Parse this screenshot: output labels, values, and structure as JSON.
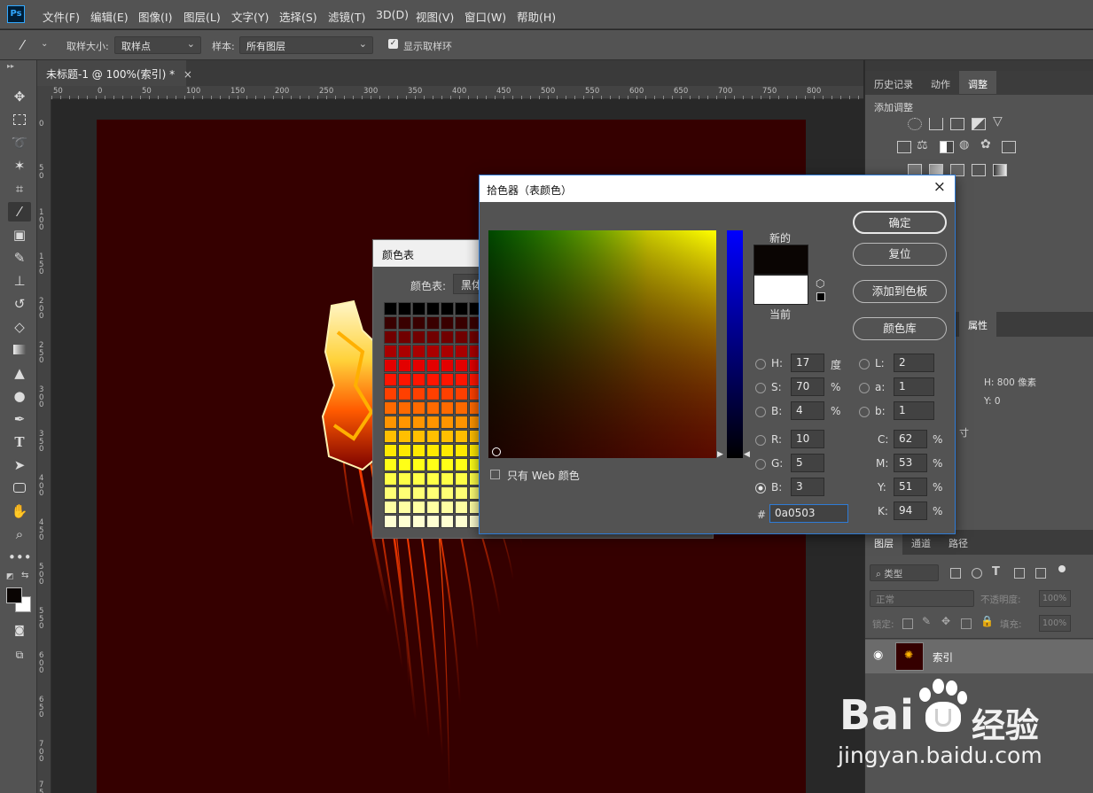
{
  "menubar": {
    "logo": "Ps",
    "items": [
      "文件(F)",
      "编辑(E)",
      "图像(I)",
      "图层(L)",
      "文字(Y)",
      "选择(S)",
      "滤镜(T)",
      "3D(D)",
      "视图(V)",
      "窗口(W)",
      "帮助(H)"
    ]
  },
  "options": {
    "sample_size_label": "取样大小:",
    "sample_size_value": "取样点",
    "sample_label": "样本:",
    "sample_value": "所有图层",
    "show_ring_label": "显示取样环"
  },
  "document_tab": {
    "title": "未标题-1 @ 100%(索引) *",
    "close": "×"
  },
  "ruler_h": [
    "50",
    "0",
    "50",
    "100",
    "150",
    "200",
    "250",
    "300",
    "350",
    "400",
    "450",
    "500",
    "550",
    "600",
    "650",
    "700",
    "750",
    "800"
  ],
  "ruler_v": [
    "0",
    "50",
    "100",
    "150",
    "200",
    "250",
    "300",
    "350",
    "400",
    "450",
    "500",
    "550",
    "600",
    "650",
    "700",
    "750"
  ],
  "colortable": {
    "title": "颜色表",
    "table_label": "颜色表:",
    "table_value": "黑体"
  },
  "picker": {
    "title": "拾色器（表颜色）",
    "close": "×",
    "new_label": "新的",
    "current_label": "当前",
    "new_color": "#0a0503",
    "current_color": "#ffffff",
    "ok": "确定",
    "reset": "复位",
    "add_swatch": "添加到色板",
    "color_libraries": "颜色库",
    "web_only": "只有 Web 颜色",
    "hsb": [
      {
        "label": "H:",
        "value": "17",
        "unit": "度"
      },
      {
        "label": "S:",
        "value": "70",
        "unit": "%"
      },
      {
        "label": "B:",
        "value": "4",
        "unit": "%"
      }
    ],
    "rgb": [
      {
        "label": "R:",
        "value": "10"
      },
      {
        "label": "G:",
        "value": "5"
      },
      {
        "label": "B:",
        "value": "3"
      }
    ],
    "lab": [
      {
        "label": "L:",
        "value": "2"
      },
      {
        "label": "a:",
        "value": "1"
      },
      {
        "label": "b:",
        "value": "1"
      }
    ],
    "cmyk": [
      {
        "label": "C:",
        "value": "62",
        "unit": "%"
      },
      {
        "label": "M:",
        "value": "53",
        "unit": "%"
      },
      {
        "label": "Y:",
        "value": "51",
        "unit": "%"
      },
      {
        "label": "K:",
        "value": "94",
        "unit": "%"
      }
    ],
    "hex_label": "#",
    "hex_value": "0a0503"
  },
  "right_panel": {
    "tabs": [
      "历史记录",
      "动作",
      "调整"
    ],
    "add_adjustment": "添加调整",
    "properties_tab": "属性",
    "prop_h": "H:  800 像素",
    "prop_y": "Y:  0",
    "prop_partial": "寸",
    "layers_tabs": [
      "图层",
      "通道",
      "路径"
    ],
    "filter_kind": "类型",
    "blend_mode": "正常",
    "opacity_label": "不透明度:",
    "opacity_value": "100%",
    "lock_label": "锁定:",
    "fill_label": "填充:",
    "fill_value": "100%",
    "layer_name": "索引"
  },
  "watermark": {
    "brand": "Bai",
    "brand_tail": "经验",
    "url": "jingyan.baidu.com"
  }
}
